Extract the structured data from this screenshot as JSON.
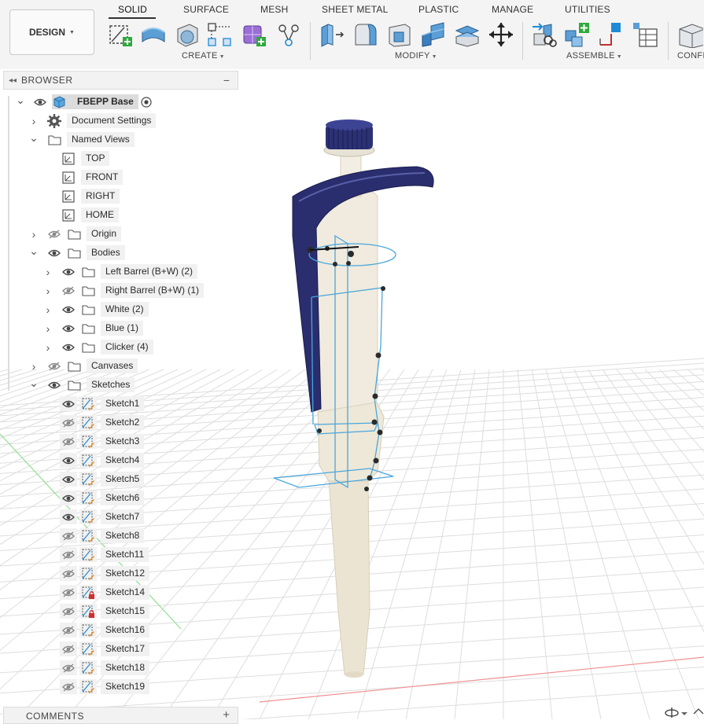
{
  "toolbar": {
    "workspace": "DESIGN",
    "tabs": [
      "SOLID",
      "SURFACE",
      "MESH",
      "SHEET METAL",
      "PLASTIC",
      "MANAGE",
      "UTILITIES"
    ],
    "active_tab": "SOLID",
    "groups": [
      "CREATE",
      "MODIFY",
      "ASSEMBLE",
      "CONFI"
    ],
    "create_tools": [
      "new-sketch-icon",
      "extrude-icon",
      "revolve-icon",
      "pattern-icon",
      "form-icon",
      "derive-icon"
    ],
    "modify_tools": [
      "press-pull-icon",
      "fillet-icon",
      "shell-icon",
      "combine-icon",
      "replace-face-icon",
      "move-copy-icon"
    ],
    "assemble_tools": [
      "as-built-joint-icon",
      "new-component-icon",
      "joint-origin-icon",
      "bom-icon"
    ],
    "configure_tools": [
      "configure-icon"
    ]
  },
  "browser": {
    "title": "BROWSER",
    "root": "FBEPP Base",
    "items": {
      "document_settings": "Document Settings",
      "named_views": "Named Views",
      "views": [
        "TOP",
        "FRONT",
        "RIGHT",
        "HOME"
      ],
      "origin": "Origin",
      "bodies": "Bodies",
      "body_list": [
        "Left Barrel (B+W) (2)",
        "Right Barrel (B+W) (1)",
        "White (2)",
        "Blue (1)",
        "Clicker (4)"
      ],
      "canvases": "Canvases",
      "sketches": "Sketches",
      "sketch_list": [
        "Sketch1",
        "Sketch2",
        "Sketch3",
        "Sketch4",
        "Sketch5",
        "Sketch6",
        "Sketch7",
        "Sketch8",
        "Sketch11",
        "Sketch12",
        "Sketch14",
        "Sketch15",
        "Sketch16",
        "Sketch17",
        "Sketch18",
        "Sketch19"
      ]
    }
  },
  "comments": {
    "title": "COMMENTS"
  },
  "colors": {
    "accent_blue": "#1f8ad6",
    "sketch_blue": "#4aa6dc",
    "pipette_body": "#ece6d6",
    "pipette_blue": "#2a2e6e",
    "grid_line": "#d8d8d8"
  }
}
